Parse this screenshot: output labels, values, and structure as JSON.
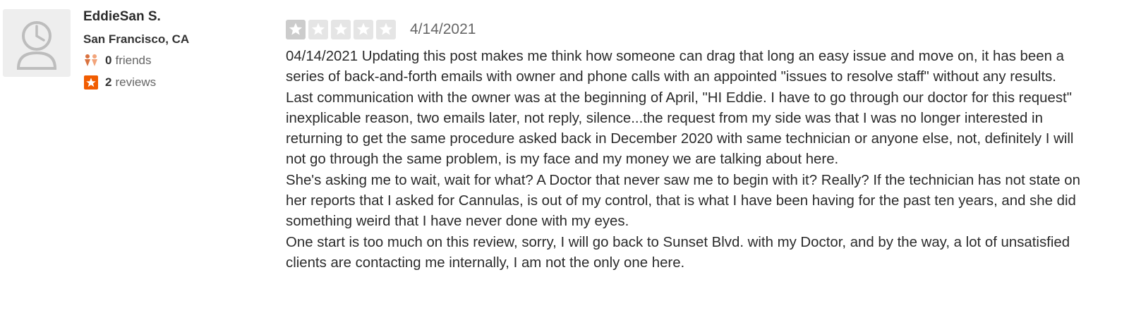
{
  "user": {
    "name": "EddieSan S.",
    "location": "San Francisco, CA",
    "friends_count": "0",
    "friends_label": "friends",
    "reviews_count": "2",
    "reviews_label": "reviews",
    "friends_icon": "friends-icon",
    "reviews_icon": "review-star-icon",
    "avatar_icon": "default-avatar-icon"
  },
  "review": {
    "rating": 1,
    "max_rating": 5,
    "date": "4/14/2021",
    "paragraphs": [
      "04/14/2021 Updating this post makes me think how someone can drag that long an easy issue and move on, it has been a series of back-and-forth emails with owner and phone calls with an appointed \"issues to resolve staff\" without any results.",
      "Last communication with the owner was at the beginning of April, \"HI Eddie. I have to go through our doctor for this request\" inexplicable reason, two emails later, not reply, silence...the request from my side was that I was no longer interested in returning to get the same procedure asked back in December 2020 with same technician or anyone else, not, definitely I will not go through the same problem, is my face and my money we are talking about here.",
      "She's asking me to wait, wait for what? A Doctor that never saw me to begin with it? Really? If the technician has not state on her reports that I asked for Cannulas, is out of my control, that is what I have been having for the past ten years, and she did something weird that I have never done with my eyes.",
      "One start is too much on this review, sorry, I will go back to Sunset Blvd. with my Doctor, and by the way, a lot of unsatisfied clients are contacting me internally, I am not the only one here."
    ]
  },
  "colors": {
    "star_filled_bg": "#cccccc",
    "star_empty_bg": "#e5e5e5",
    "friends_icon_color": "#e08a5a",
    "reviews_icon_color": "#f15c00"
  }
}
